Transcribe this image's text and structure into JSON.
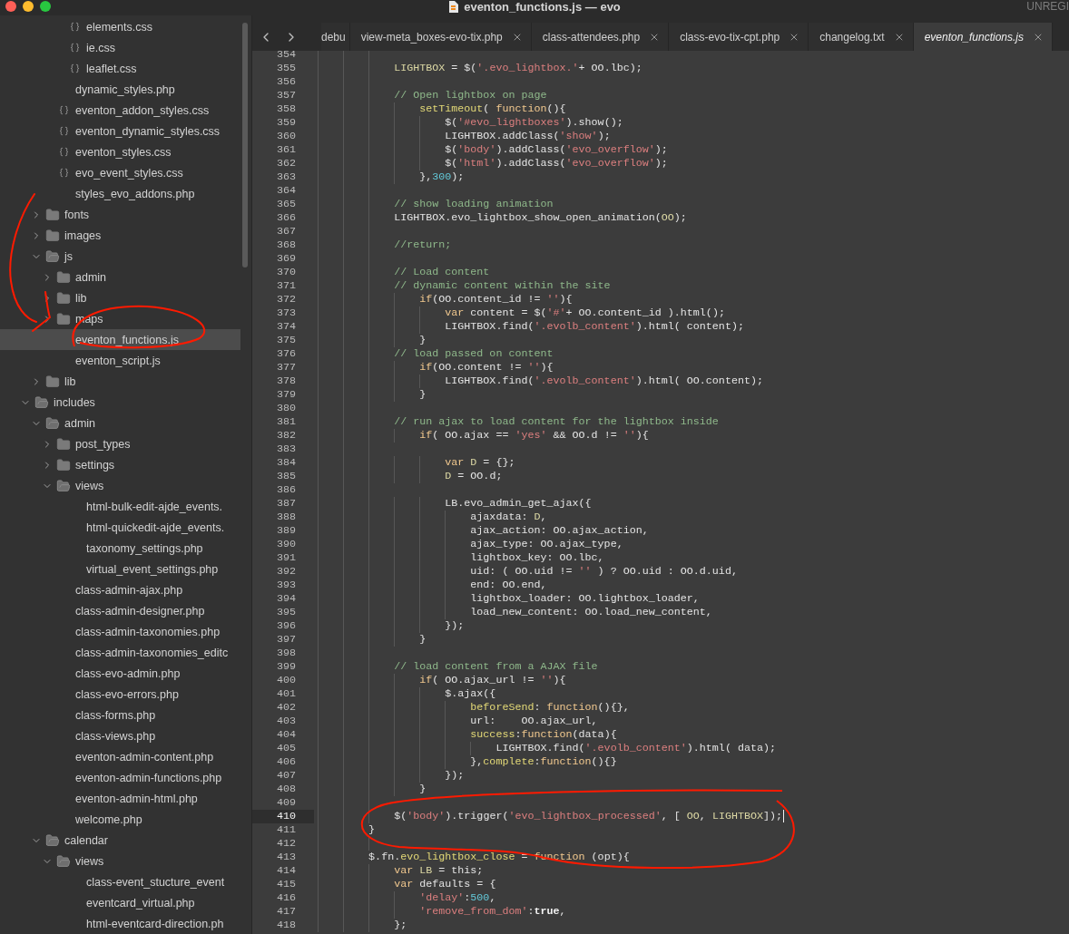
{
  "window": {
    "title": "eventon_functions.js — evo",
    "badge": "UNREGI"
  },
  "sidebar": {
    "tree": [
      {
        "children": [
          {
            "children": [
              {
                "children": [
                  {
                    "kind": "style-file",
                    "label": "elements.css",
                    "selected": false
                  },
                  {
                    "kind": "style-file",
                    "label": "ie.css",
                    "selected": false
                  },
                  {
                    "kind": "style-file",
                    "label": "leaflet.css",
                    "selected": false
                  }
                ]
              },
              {
                "kind": "file",
                "label": "dynamic_styles.php",
                "selected": false
              },
              {
                "kind": "style-file",
                "label": "eventon_addon_styles.css",
                "selected": false
              },
              {
                "kind": "style-file",
                "label": "eventon_dynamic_styles.css",
                "selected": false
              },
              {
                "kind": "style-file",
                "label": "eventon_styles.css",
                "selected": false
              },
              {
                "kind": "style-file",
                "label": "evo_event_styles.css",
                "selected": false
              },
              {
                "kind": "file",
                "label": "styles_evo_addons.php",
                "selected": false
              }
            ]
          },
          {
            "kind": "folder",
            "label": "fonts",
            "expanded": false,
            "selected": false
          },
          {
            "kind": "folder",
            "label": "images",
            "expanded": false,
            "selected": false
          },
          {
            "kind": "folder",
            "label": "js",
            "expanded": true,
            "selected": false,
            "children": [
              {
                "kind": "folder",
                "label": "admin",
                "expanded": false,
                "selected": false
              },
              {
                "kind": "folder",
                "label": "lib",
                "expanded": false,
                "selected": false
              },
              {
                "kind": "folder",
                "label": "maps",
                "expanded": false,
                "selected": false
              },
              {
                "kind": "file",
                "label": "eventon_functions.js",
                "selected": true
              },
              {
                "kind": "file",
                "label": "eventon_script.js",
                "selected": false
              }
            ]
          },
          {
            "kind": "folder",
            "label": "lib",
            "expanded": false,
            "selected": false
          }
        ]
      },
      {
        "kind": "folder",
        "label": "includes",
        "expanded": true,
        "selected": false,
        "children": [
          {
            "kind": "folder",
            "label": "admin",
            "expanded": true,
            "selected": false,
            "children": [
              {
                "kind": "folder",
                "label": "post_types",
                "expanded": false,
                "selected": false
              },
              {
                "kind": "folder",
                "label": "settings",
                "expanded": false,
                "selected": false
              },
              {
                "kind": "folder",
                "label": "views",
                "expanded": true,
                "selected": false,
                "children": [
                  {
                    "kind": "file",
                    "label": "html-bulk-edit-ajde_events.",
                    "selected": false
                  },
                  {
                    "kind": "file",
                    "label": "html-quickedit-ajde_events.",
                    "selected": false
                  },
                  {
                    "kind": "file",
                    "label": "taxonomy_settings.php",
                    "selected": false
                  },
                  {
                    "kind": "file",
                    "label": "virtual_event_settings.php",
                    "selected": false
                  }
                ]
              },
              {
                "kind": "file",
                "label": "class-admin-ajax.php",
                "selected": false
              },
              {
                "kind": "file",
                "label": "class-admin-designer.php",
                "selected": false
              },
              {
                "kind": "file",
                "label": "class-admin-taxonomies.php",
                "selected": false
              },
              {
                "kind": "file",
                "label": "class-admin-taxonomies_editc",
                "selected": false
              },
              {
                "kind": "file",
                "label": "class-evo-admin.php",
                "selected": false
              },
              {
                "kind": "file",
                "label": "class-evo-errors.php",
                "selected": false
              },
              {
                "kind": "file",
                "label": "class-forms.php",
                "selected": false
              },
              {
                "kind": "file",
                "label": "class-views.php",
                "selected": false
              },
              {
                "kind": "file",
                "label": "eventon-admin-content.php",
                "selected": false
              },
              {
                "kind": "file",
                "label": "eventon-admin-functions.php",
                "selected": false
              },
              {
                "kind": "file",
                "label": "eventon-admin-html.php",
                "selected": false
              },
              {
                "kind": "file",
                "label": "welcome.php",
                "selected": false
              }
            ]
          },
          {
            "kind": "folder",
            "label": "calendar",
            "expanded": true,
            "selected": false,
            "children": [
              {
                "kind": "folder",
                "label": "views",
                "expanded": true,
                "selected": false,
                "children": [
                  {
                    "kind": "file",
                    "label": "class-event_stucture_event",
                    "selected": false
                  },
                  {
                    "kind": "file",
                    "label": "eventcard_virtual.php",
                    "selected": false
                  },
                  {
                    "kind": "file",
                    "label": "html-eventcard-direction.ph",
                    "selected": false
                  }
                ]
              }
            ]
          }
        ]
      }
    ]
  },
  "tabs": [
    {
      "label": "debu",
      "closable": false,
      "selected": false
    },
    {
      "label": "view-meta_boxes-evo-tix.php",
      "closable": true,
      "selected": false
    },
    {
      "label": "class-attendees.php",
      "closable": true,
      "selected": false
    },
    {
      "label": "class-evo-tix-cpt.php",
      "closable": true,
      "selected": false
    },
    {
      "label": "changelog.txt",
      "closable": true,
      "selected": false
    },
    {
      "label": "eventon_functions.js",
      "closable": true,
      "selected": true
    }
  ],
  "editor": {
    "lines": [
      {
        "number": "354",
        "current": false
      },
      {
        "number": "355",
        "current": false,
        "tokens": [
          {
            "kind": "var",
            "text": "            LIGHTBOX"
          },
          {
            "kind": "plain",
            "text": " = $("
          },
          {
            "kind": "str",
            "text": "'.evo_lightbox.'"
          },
          {
            "kind": "plain",
            "text": "+ OO.lbc);"
          }
        ]
      },
      {
        "number": "356",
        "current": false
      },
      {
        "number": "357",
        "current": false,
        "tokens": [
          {
            "kind": "com",
            "text": "            // Open lightbox on page"
          }
        ]
      },
      {
        "number": "358",
        "current": false,
        "tokens": [
          {
            "kind": "fn",
            "text": "                setTimeout"
          },
          {
            "kind": "plain",
            "text": "( "
          },
          {
            "kind": "kw",
            "text": "function"
          },
          {
            "kind": "plain",
            "text": "(){"
          }
        ]
      },
      {
        "number": "359",
        "current": false,
        "tokens": [
          {
            "kind": "plain",
            "text": "                    $("
          },
          {
            "kind": "str",
            "text": "'#evo_lightboxes'"
          },
          {
            "kind": "plain",
            "text": ").show();"
          }
        ]
      },
      {
        "number": "360",
        "current": false,
        "tokens": [
          {
            "kind": "plain",
            "text": "                    LIGHTBOX.addClass("
          },
          {
            "kind": "str",
            "text": "'show'"
          },
          {
            "kind": "plain",
            "text": ");"
          }
        ]
      },
      {
        "number": "361",
        "current": false,
        "tokens": [
          {
            "kind": "plain",
            "text": "                    $("
          },
          {
            "kind": "str",
            "text": "'body'"
          },
          {
            "kind": "plain",
            "text": ").addClass("
          },
          {
            "kind": "str",
            "text": "'evo_overflow'"
          },
          {
            "kind": "plain",
            "text": ");"
          }
        ]
      },
      {
        "number": "362",
        "current": false,
        "tokens": [
          {
            "kind": "plain",
            "text": "                    $("
          },
          {
            "kind": "str",
            "text": "'html'"
          },
          {
            "kind": "plain",
            "text": ").addClass("
          },
          {
            "kind": "str",
            "text": "'evo_overflow'"
          },
          {
            "kind": "plain",
            "text": ");"
          }
        ]
      },
      {
        "number": "363",
        "current": false,
        "tokens": [
          {
            "kind": "plain",
            "text": "                },"
          },
          {
            "kind": "num",
            "text": "300"
          },
          {
            "kind": "plain",
            "text": ");"
          }
        ]
      },
      {
        "number": "364",
        "current": false
      },
      {
        "number": "365",
        "current": false,
        "tokens": [
          {
            "kind": "com",
            "text": "            // show loading animation"
          }
        ]
      },
      {
        "number": "366",
        "current": false,
        "tokens": [
          {
            "kind": "plain",
            "text": "            LIGHTBOX.evo_lightbox_show_open_animation("
          },
          {
            "kind": "var",
            "text": "OO"
          },
          {
            "kind": "plain",
            "text": ");"
          }
        ]
      },
      {
        "number": "367",
        "current": false
      },
      {
        "number": "368",
        "current": false,
        "tokens": [
          {
            "kind": "com",
            "text": "            //return;"
          }
        ]
      },
      {
        "number": "369",
        "current": false
      },
      {
        "number": "370",
        "current": false,
        "tokens": [
          {
            "kind": "com",
            "text": "            // Load content"
          }
        ]
      },
      {
        "number": "371",
        "current": false,
        "tokens": [
          {
            "kind": "com",
            "text": "            // dynamic content within the site"
          }
        ]
      },
      {
        "number": "372",
        "current": false,
        "tokens": [
          {
            "kind": "kw",
            "text": "                if"
          },
          {
            "kind": "plain",
            "text": "(OO.content_id != "
          },
          {
            "kind": "str",
            "text": "''"
          },
          {
            "kind": "plain",
            "text": "){"
          }
        ]
      },
      {
        "number": "373",
        "current": false,
        "tokens": [
          {
            "kind": "kw",
            "text": "                    var"
          },
          {
            "kind": "plain",
            "text": " content = $("
          },
          {
            "kind": "str",
            "text": "'#'"
          },
          {
            "kind": "plain",
            "text": "+ OO.content_id ).html();"
          }
        ]
      },
      {
        "number": "374",
        "current": false,
        "tokens": [
          {
            "kind": "plain",
            "text": "                    LIGHTBOX.find("
          },
          {
            "kind": "str",
            "text": "'.evolb_content'"
          },
          {
            "kind": "plain",
            "text": ").html( content);"
          }
        ]
      },
      {
        "number": "375",
        "current": false,
        "tokens": [
          {
            "kind": "plain",
            "text": "                }"
          }
        ]
      },
      {
        "number": "376",
        "current": false,
        "tokens": [
          {
            "kind": "com",
            "text": "            // load passed on content"
          }
        ]
      },
      {
        "number": "377",
        "current": false,
        "tokens": [
          {
            "kind": "kw",
            "text": "                if"
          },
          {
            "kind": "plain",
            "text": "(OO.content != "
          },
          {
            "kind": "str",
            "text": "''"
          },
          {
            "kind": "plain",
            "text": "){"
          }
        ]
      },
      {
        "number": "378",
        "current": false,
        "tokens": [
          {
            "kind": "plain",
            "text": "                    LIGHTBOX.find("
          },
          {
            "kind": "str",
            "text": "'.evolb_content'"
          },
          {
            "kind": "plain",
            "text": ").html( OO.content);"
          }
        ]
      },
      {
        "number": "379",
        "current": false,
        "tokens": [
          {
            "kind": "plain",
            "text": "                }"
          }
        ]
      },
      {
        "number": "380",
        "current": false
      },
      {
        "number": "381",
        "current": false,
        "tokens": [
          {
            "kind": "com",
            "text": "            // run ajax to load content for the lightbox inside"
          }
        ]
      },
      {
        "number": "382",
        "current": false,
        "tokens": [
          {
            "kind": "kw",
            "text": "                if"
          },
          {
            "kind": "plain",
            "text": "( OO.ajax == "
          },
          {
            "kind": "str",
            "text": "'yes'"
          },
          {
            "kind": "plain",
            "text": " && OO.d != "
          },
          {
            "kind": "str",
            "text": "''"
          },
          {
            "kind": "plain",
            "text": "){"
          }
        ]
      },
      {
        "number": "383",
        "current": false
      },
      {
        "number": "384",
        "current": false,
        "tokens": [
          {
            "kind": "kw",
            "text": "                    var"
          },
          {
            "kind": "var",
            "text": " D"
          },
          {
            "kind": "plain",
            "text": " = {};"
          }
        ]
      },
      {
        "number": "385",
        "current": false,
        "tokens": [
          {
            "kind": "var",
            "text": "                    D"
          },
          {
            "kind": "plain",
            "text": " = OO.d;"
          }
        ]
      },
      {
        "number": "386",
        "current": false
      },
      {
        "number": "387",
        "current": false,
        "tokens": [
          {
            "kind": "plain",
            "text": "                    LB.evo_admin_get_ajax({"
          }
        ]
      },
      {
        "number": "388",
        "current": false,
        "tokens": [
          {
            "kind": "plain",
            "text": "                        ajaxdata: "
          },
          {
            "kind": "var",
            "text": "D"
          },
          {
            "kind": "plain",
            "text": ","
          }
        ]
      },
      {
        "number": "389",
        "current": false,
        "tokens": [
          {
            "kind": "plain",
            "text": "                        ajax_action: OO.ajax_action,"
          }
        ]
      },
      {
        "number": "390",
        "current": false,
        "tokens": [
          {
            "kind": "plain",
            "text": "                        ajax_type: OO.ajax_type,"
          }
        ]
      },
      {
        "number": "391",
        "current": false,
        "tokens": [
          {
            "kind": "plain",
            "text": "                        lightbox_key: OO.lbc,"
          }
        ]
      },
      {
        "number": "392",
        "current": false,
        "tokens": [
          {
            "kind": "plain",
            "text": "                        uid: ( OO.uid != "
          },
          {
            "kind": "str",
            "text": "''"
          },
          {
            "kind": "plain",
            "text": " ) ? OO.uid : OO.d.uid,"
          }
        ]
      },
      {
        "number": "393",
        "current": false,
        "tokens": [
          {
            "kind": "plain",
            "text": "                        end: OO.end,"
          }
        ]
      },
      {
        "number": "394",
        "current": false,
        "tokens": [
          {
            "kind": "plain",
            "text": "                        lightbox_loader: OO.lightbox_loader,"
          }
        ]
      },
      {
        "number": "395",
        "current": false,
        "tokens": [
          {
            "kind": "plain",
            "text": "                        load_new_content: OO.load_new_content,"
          }
        ]
      },
      {
        "number": "396",
        "current": false,
        "tokens": [
          {
            "kind": "plain",
            "text": "                    });"
          }
        ]
      },
      {
        "number": "397",
        "current": false,
        "tokens": [
          {
            "kind": "plain",
            "text": "                }"
          }
        ]
      },
      {
        "number": "398",
        "current": false
      },
      {
        "number": "399",
        "current": false,
        "tokens": [
          {
            "kind": "com",
            "text": "            // load content from a AJAX file"
          }
        ]
      },
      {
        "number": "400",
        "current": false,
        "tokens": [
          {
            "kind": "kw",
            "text": "                if"
          },
          {
            "kind": "plain",
            "text": "( OO.ajax_url != "
          },
          {
            "kind": "str",
            "text": "''"
          },
          {
            "kind": "plain",
            "text": "){"
          }
        ]
      },
      {
        "number": "401",
        "current": false,
        "tokens": [
          {
            "kind": "plain",
            "text": "                    $.ajax({"
          }
        ]
      },
      {
        "number": "402",
        "current": false,
        "tokens": [
          {
            "kind": "fn",
            "text": "                        beforeSend"
          },
          {
            "kind": "plain",
            "text": ": "
          },
          {
            "kind": "kw",
            "text": "function"
          },
          {
            "kind": "plain",
            "text": "(){},"
          }
        ]
      },
      {
        "number": "403",
        "current": false,
        "tokens": [
          {
            "kind": "plain",
            "text": "                        url:    OO.ajax_url,"
          }
        ]
      },
      {
        "number": "404",
        "current": false,
        "tokens": [
          {
            "kind": "fn",
            "text": "                        success"
          },
          {
            "kind": "plain",
            "text": ":"
          },
          {
            "kind": "kw",
            "text": "function"
          },
          {
            "kind": "plain",
            "text": "(data){"
          }
        ]
      },
      {
        "number": "405",
        "current": false,
        "tokens": [
          {
            "kind": "plain",
            "text": "                            LIGHTBOX.find("
          },
          {
            "kind": "str",
            "text": "'.evolb_content'"
          },
          {
            "kind": "plain",
            "text": ").html( data);"
          }
        ]
      },
      {
        "number": "406",
        "current": false,
        "tokens": [
          {
            "kind": "plain",
            "text": "                        },"
          },
          {
            "kind": "fn",
            "text": "complete"
          },
          {
            "kind": "plain",
            "text": ":"
          },
          {
            "kind": "kw",
            "text": "function"
          },
          {
            "kind": "plain",
            "text": "(){}"
          }
        ]
      },
      {
        "number": "407",
        "current": false,
        "tokens": [
          {
            "kind": "plain",
            "text": "                    });"
          }
        ]
      },
      {
        "number": "408",
        "current": false,
        "tokens": [
          {
            "kind": "plain",
            "text": "                }"
          }
        ]
      },
      {
        "number": "409",
        "current": false
      },
      {
        "number": "410",
        "current": true,
        "tokens": [
          {
            "kind": "plain",
            "text": "            $("
          },
          {
            "kind": "str",
            "text": "'body'"
          },
          {
            "kind": "plain",
            "text": ").trigger("
          },
          {
            "kind": "str",
            "text": "'evo_lightbox_processed'"
          },
          {
            "kind": "plain",
            "text": ", [ "
          },
          {
            "kind": "var",
            "text": "OO"
          },
          {
            "kind": "plain",
            "text": ", "
          },
          {
            "kind": "var",
            "text": "LIGHTBOX"
          },
          {
            "kind": "plain",
            "text": "]);"
          }
        ]
      },
      {
        "number": "411",
        "current": false,
        "tokens": [
          {
            "kind": "plain",
            "text": "        }"
          }
        ]
      },
      {
        "number": "412",
        "current": false
      },
      {
        "number": "413",
        "current": false,
        "tokens": [
          {
            "kind": "plain",
            "text": "        $.fn."
          },
          {
            "kind": "fn",
            "text": "evo_lightbox_close"
          },
          {
            "kind": "plain",
            "text": " = "
          },
          {
            "kind": "kw",
            "text": "function"
          },
          {
            "kind": "plain",
            "text": " (opt){"
          }
        ]
      },
      {
        "number": "414",
        "current": false,
        "tokens": [
          {
            "kind": "kw",
            "text": "            var"
          },
          {
            "kind": "var",
            "text": " LB"
          },
          {
            "kind": "plain",
            "text": " = this;"
          }
        ]
      },
      {
        "number": "415",
        "current": false,
        "tokens": [
          {
            "kind": "kw",
            "text": "            var"
          },
          {
            "kind": "plain",
            "text": " defaults = {"
          }
        ]
      },
      {
        "number": "416",
        "current": false,
        "tokens": [
          {
            "kind": "str",
            "text": "                'delay'"
          },
          {
            "kind": "plain",
            "text": ":"
          },
          {
            "kind": "num",
            "text": "500"
          },
          {
            "kind": "plain",
            "text": ","
          }
        ]
      },
      {
        "number": "417",
        "current": false,
        "tokens": [
          {
            "kind": "str",
            "text": "                'remove_from_dom'"
          },
          {
            "kind": "plain",
            "text": ":"
          },
          {
            "kind": "bold",
            "text": "true"
          },
          {
            "kind": "plain",
            "text": ","
          }
        ]
      },
      {
        "number": "418",
        "current": false,
        "tokens": [
          {
            "kind": "plain",
            "text": "            };"
          }
        ]
      }
    ]
  }
}
